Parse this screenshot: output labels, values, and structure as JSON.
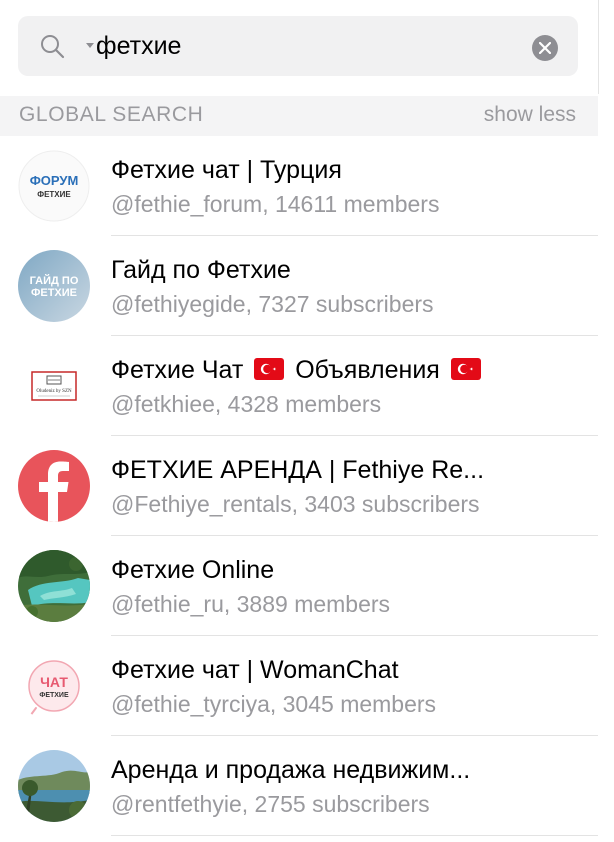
{
  "search": {
    "query": "фетхие"
  },
  "section": {
    "title": "GLOBAL SEARCH",
    "toggle_label": "show less"
  },
  "results": [
    {
      "title": "Фетхие чат | Турция",
      "subtitle": "@fethie_forum, 14611 members",
      "avatar_text_line1": "ФОРУМ",
      "avatar_text_line2": "ФЕТХИЕ"
    },
    {
      "title": "Гайд по Фетхие",
      "subtitle": "@fethiyegide, 7327 subscribers",
      "avatar_text_line1": "ГАЙД ПО",
      "avatar_text_line2": "ФЕТХИЕ"
    },
    {
      "title_part1": "Фетхие Чат",
      "title_part2": "Объявления",
      "subtitle": "@fetkhiee, 4328 members",
      "avatar_text": "Oludeniz by SZN",
      "flag_icon": "turkey-flag"
    },
    {
      "title": "ФЕТХИЕ АРЕНДА | Fethiye Re...",
      "subtitle": "@Fethiye_rentals, 3403 subscribers",
      "avatar_icon": "facebook-f"
    },
    {
      "title": "Фетхие Online",
      "subtitle": "@fethie_ru, 3889 members"
    },
    {
      "title": "Фетхие чат | WomanChat",
      "subtitle": "@fethie_tyrciya, 3045 members",
      "avatar_text_line1": "ЧАТ",
      "avatar_text_line2": "ФЕТХИЕ"
    },
    {
      "title": "Аренда и продажа недвижим...",
      "subtitle": "@rentfethyie, 2755 subscribers"
    }
  ],
  "colors": {
    "accent_blue": "#2a6fb8",
    "secondary_text": "#9a9a9e",
    "facebook_red": "#e8545b",
    "turkey_red": "#e30a17"
  }
}
